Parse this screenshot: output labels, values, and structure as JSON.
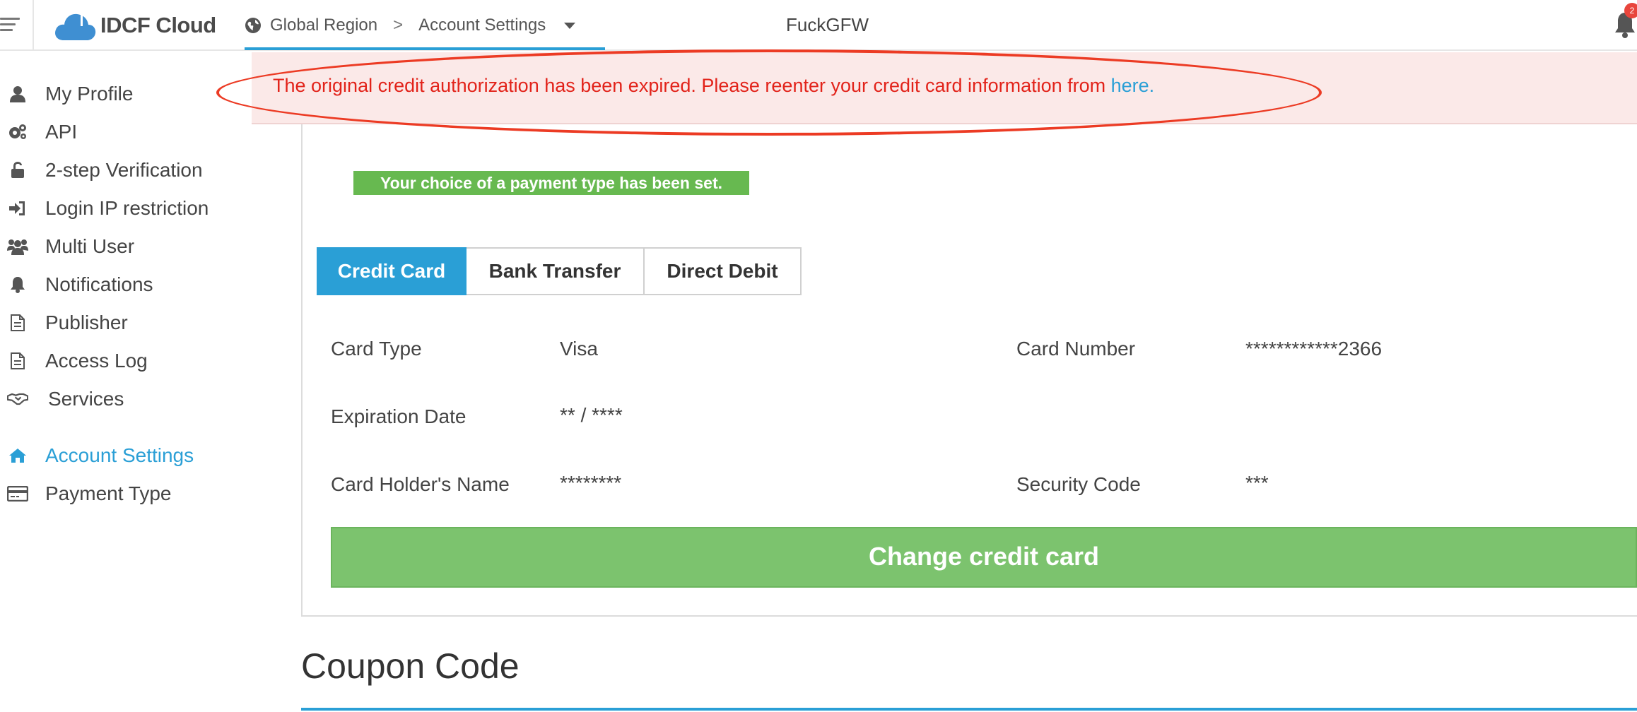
{
  "header": {
    "logo_text": "IDCF Cloud",
    "region": "Global Region",
    "breadcrumb_separator": ">",
    "current_page": "Account Settings",
    "account_name": "FuckGFW",
    "notification_count": "2"
  },
  "sidebar": {
    "items": [
      {
        "label": "My Profile",
        "icon": "user-icon"
      },
      {
        "label": "API",
        "icon": "gears-icon"
      },
      {
        "label": "2-step Verification",
        "icon": "unlock-icon"
      },
      {
        "label": "Login IP restriction",
        "icon": "sign-in-icon"
      },
      {
        "label": "Multi User",
        "icon": "users-icon"
      },
      {
        "label": "Notifications",
        "icon": "bell-icon"
      },
      {
        "label": "Publisher",
        "icon": "document-icon"
      },
      {
        "label": "Access Log",
        "icon": "document-icon"
      },
      {
        "label": "Services",
        "icon": "handshake-icon"
      },
      {
        "label": "Account Settings",
        "icon": "home-icon",
        "active": true
      },
      {
        "label": "Payment Type",
        "icon": "credit-card-icon"
      }
    ]
  },
  "alert": {
    "message": "The original credit authorization has been expired. Please reenter your credit card information from ",
    "link_text": "here."
  },
  "payment": {
    "success_message": "Your choice of a payment type has been set.",
    "tabs": [
      "Credit Card",
      "Bank Transfer",
      "Direct Debit"
    ],
    "active_tab": "Credit Card",
    "fields": {
      "card_type_label": "Card Type",
      "card_type_value": "Visa",
      "card_number_label": "Card Number",
      "card_number_value": "************2366",
      "expiration_label": "Expiration Date",
      "expiration_value": "** / ****",
      "holder_label": "Card Holder's Name",
      "holder_value": "********",
      "security_label": "Security Code",
      "security_value": "***"
    },
    "change_button": "Change credit card"
  },
  "coupon": {
    "title": "Coupon Code"
  },
  "colors": {
    "accent": "#2a9fd6",
    "alert_text": "#e2231a",
    "alert_bg": "#fbe9e8",
    "success": "#67b950",
    "button": "#7cc36e",
    "annotation": "#ec3b24"
  }
}
